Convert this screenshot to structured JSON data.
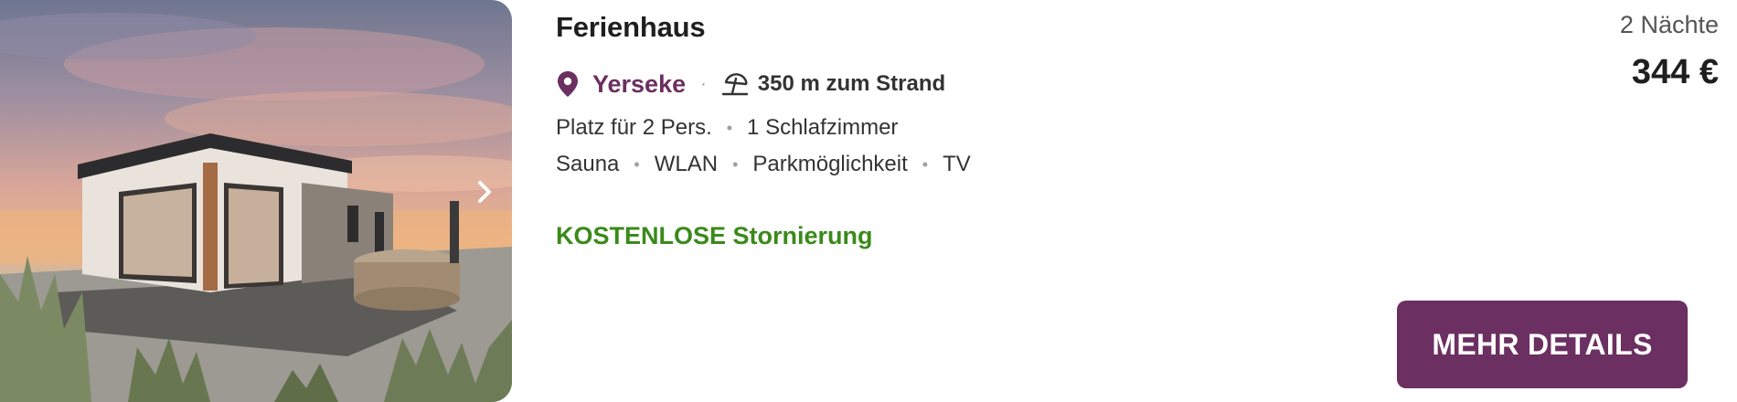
{
  "listing": {
    "title": "Ferienhaus",
    "location": "Yerseke",
    "beach_distance": "350 m zum Strand",
    "capacity": [
      "Platz für 2 Pers.",
      "1 Schlafzimmer"
    ],
    "amenities": [
      "Sauna",
      "WLAN",
      "Parkmöglichkeit",
      "TV"
    ],
    "cancellation": "KOSTENLOSE Stornierung",
    "nights": "2 Nächte",
    "price": "344 €",
    "details_button": "MEHR DETAILS"
  },
  "icons": {
    "location": "map-pin-icon",
    "beach": "beach-umbrella-icon",
    "next": "chevron-right-icon"
  },
  "colors": {
    "accent": "#6b2f61",
    "free_cancel": "#3a8a1a",
    "button_text": "#ffffff"
  }
}
